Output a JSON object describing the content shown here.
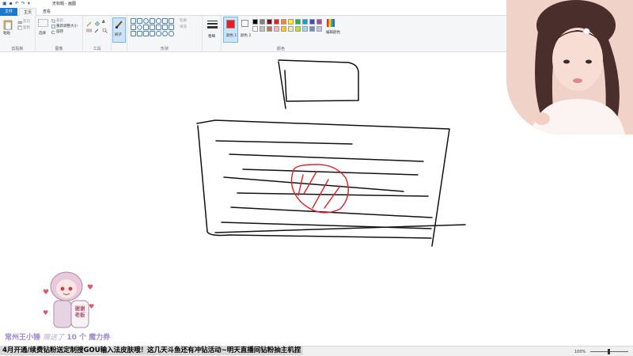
{
  "window": {
    "title": "无标题 - 画图",
    "controls": [
      "—",
      "□",
      "✕"
    ]
  },
  "tabs": [
    {
      "label": "文件"
    },
    {
      "label": "主页"
    },
    {
      "label": "查看"
    }
  ],
  "ribbon": {
    "clipboard": {
      "paste_label": "粘贴",
      "cut_label": "剪切",
      "copy_label": "复制",
      "group_label": "剪贴板"
    },
    "image": {
      "select_label": "选择",
      "crop_label": "裁剪",
      "resize_label": "重新调整大小",
      "rotate_label": "旋转",
      "group_label": "图像"
    },
    "tools": {
      "group_label": "工具"
    },
    "brushes": {
      "label": "刷子"
    },
    "shapes": {
      "outline_label": "轮廓",
      "fill_label": "填充",
      "group_label": "形状"
    },
    "size": {
      "label": "粗细"
    },
    "colors": {
      "color1_label": "颜色 1",
      "color2_label": "颜色 2",
      "edit_label": "编辑颜色",
      "group_label": "颜色",
      "color1_value": "#ed1c24",
      "color2_value": "#ffffff",
      "palette_row1": [
        "#000000",
        "#7f7f7f",
        "#880015",
        "#ed1c24",
        "#ff7f27",
        "#fff200",
        "#22b14c",
        "#00a2e8",
        "#3f48cc",
        "#a349a4"
      ],
      "palette_row2": [
        "#ffffff",
        "#c3c3c3",
        "#b97a57",
        "#ffaec9",
        "#ffc90e",
        "#efe4b0",
        "#b5e61d",
        "#99d9ea",
        "#7092be",
        "#c8bfe7"
      ]
    }
  },
  "overlay": {
    "gift_user": "常州王小锤",
    "gift_verb": "赠送了",
    "gift_count": "10 个",
    "gift_item": "魔力券",
    "sticker_text": "谢谢老板",
    "marquee": "4月开通/续费钻粉送定制搜GOU输入法皮肤哦！这几天斗鱼还有冲钻活动~明天直播间钻粉抽主机捏"
  },
  "status": {
    "zoom": "100%"
  }
}
